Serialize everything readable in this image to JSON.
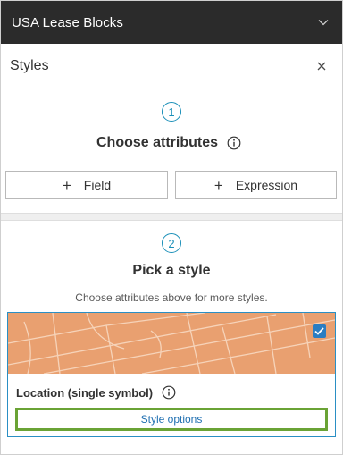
{
  "layer": {
    "title": "USA Lease Blocks",
    "collapse_icon": "chevron-down-icon"
  },
  "styles_panel": {
    "title": "Styles",
    "close_icon": "close-icon"
  },
  "step1": {
    "number": "1",
    "heading": "Choose attributes",
    "info_icon": "info-icon",
    "field_button": {
      "icon": "+",
      "label": "Field"
    },
    "expression_button": {
      "icon": "+",
      "label": "Expression"
    }
  },
  "step2": {
    "number": "2",
    "heading": "Pick a style",
    "hint": "Choose attributes above for more styles."
  },
  "style_card": {
    "label": "Location (single symbol)",
    "selected": true,
    "thumbnail_color": "#e9a070",
    "options_label": "Style options"
  },
  "colors": {
    "header_bg": "#2b2b2b",
    "accent_blue": "#1a8fb8",
    "highlight_green": "#6aa335"
  }
}
